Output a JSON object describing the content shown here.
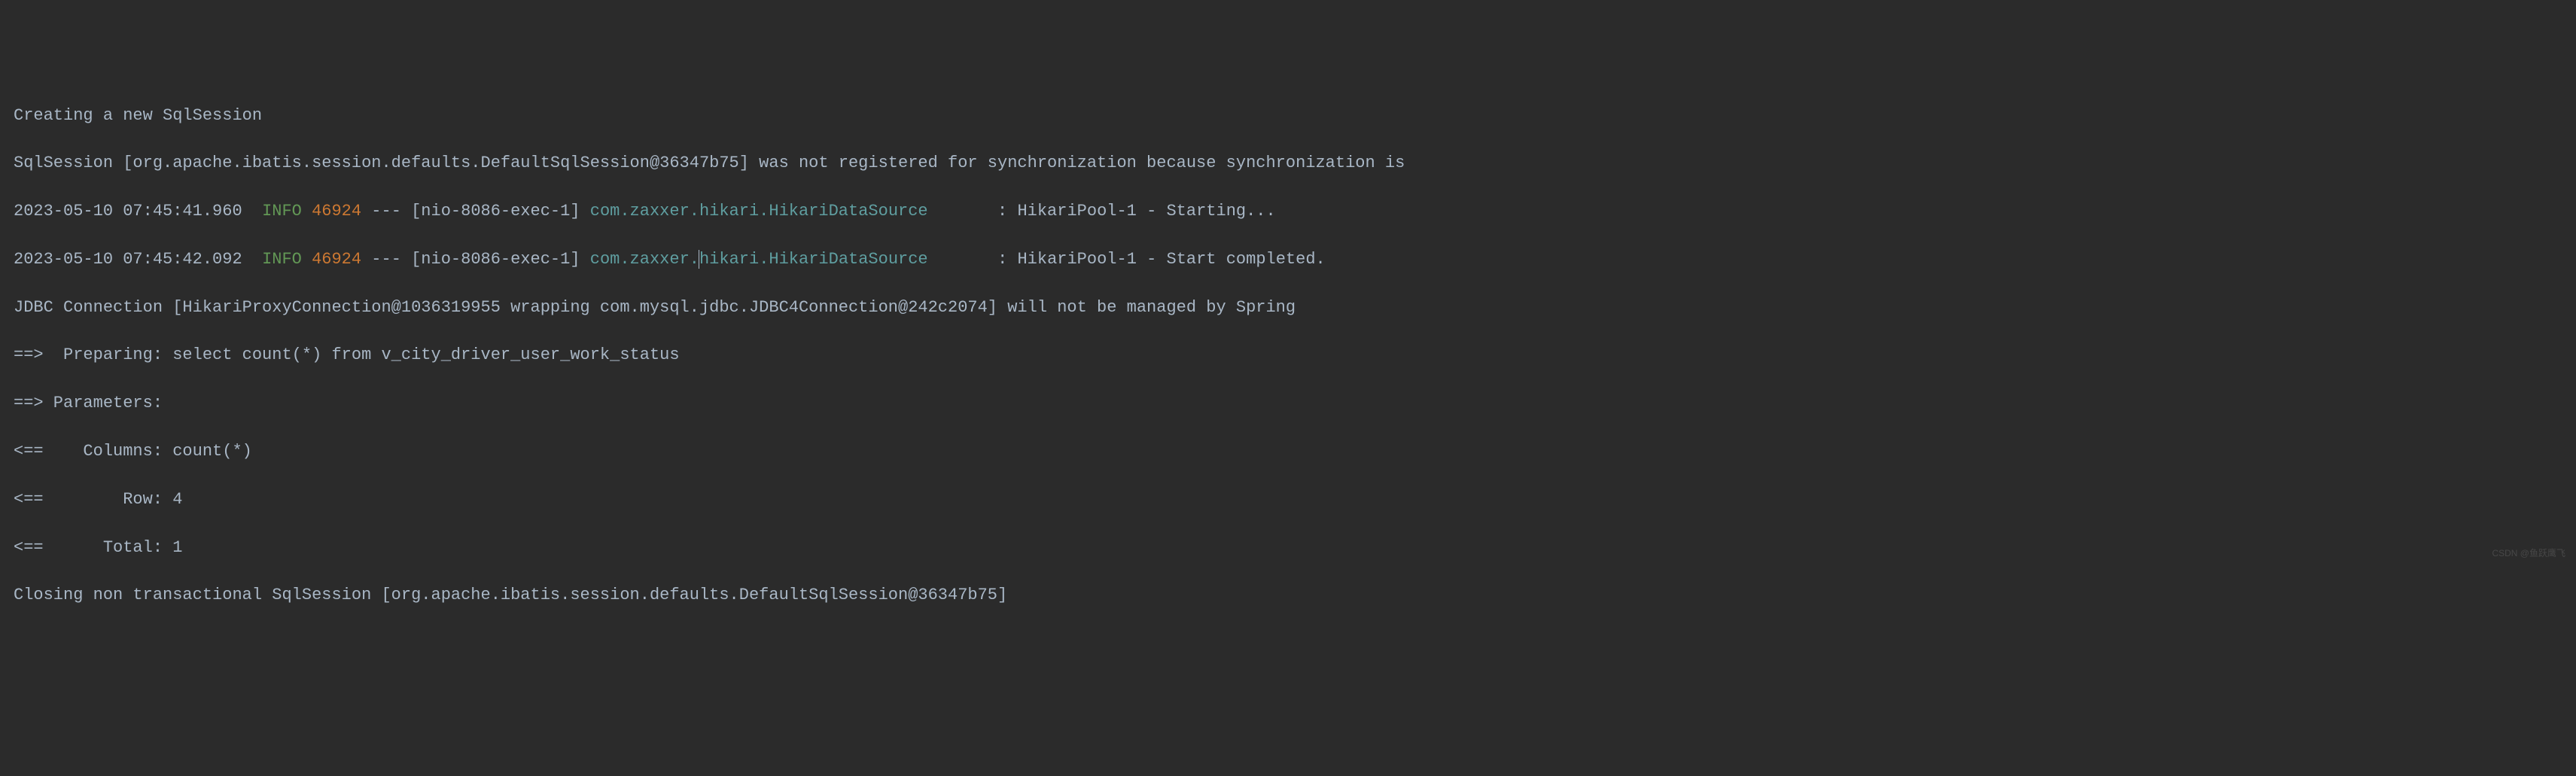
{
  "lines": {
    "l1": "Creating a new SqlSession",
    "l2": "SqlSession [org.apache.ibatis.session.defaults.DefaultSqlSession@36347b75] was not registered for synchronization because synchronization is ",
    "l3": {
      "ts": "2023-05-10 07:45:41.960  ",
      "level": "INFO",
      "sep1": " ",
      "pid": "46924",
      "sep2": " --- [nio-8086-exec-1] ",
      "logger": "com.zaxxer.hikari.HikariDataSource",
      "pad": "       ",
      "msg": ": HikariPool-1 - Starting..."
    },
    "l4": {
      "ts": "2023-05-10 07:45:42.092  ",
      "level": "INFO",
      "sep1": " ",
      "pid": "46924",
      "sep2": " --- [nio-8086-exec-1] ",
      "logger_a": "com.zaxxer.",
      "logger_b": "hikari.HikariDataSource",
      "pad": "       ",
      "msg": ": HikariPool-1 - Start completed."
    },
    "l5": "JDBC Connection [HikariProxyConnection@1036319955 wrapping com.mysql.jdbc.JDBC4Connection@242c2074] will not be managed by Spring",
    "l6": "==>  Preparing: select count(*) from v_city_driver_user_work_status",
    "l7": "==> Parameters: ",
    "l8": "<==    Columns: count(*)",
    "l9": "<==        Row: 4",
    "l10": "<==      Total: 1",
    "l11": "Closing non transactional SqlSession [org.apache.ibatis.session.defaults.DefaultSqlSession@36347b75]"
  },
  "watermark": "CSDN @鱼跃鹰飞"
}
